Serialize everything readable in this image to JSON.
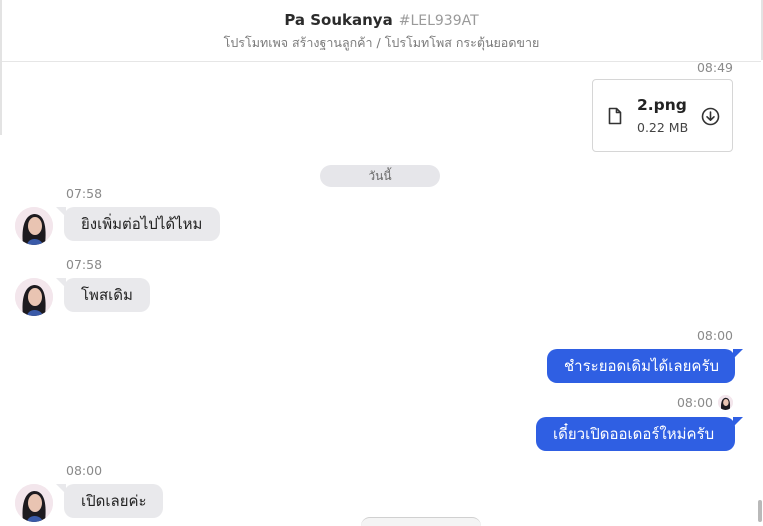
{
  "header": {
    "name": "Pa Soukanya",
    "code": "#LEL939AT",
    "tags": "โปรโมทเพจ สร้างฐานลูกค้า / โปรโมทโพส กระตุ้นยอดขาย"
  },
  "file_message": {
    "time": "08:49",
    "file_name": "2.png",
    "file_size": "0.22 MB",
    "file_icon": "document-icon",
    "download_icon": "download-circle-icon"
  },
  "day_separator": "วันนี้",
  "messages": [
    {
      "direction": "in",
      "time": "07:58",
      "text": "ยิงเพิ่มต่อไปได้ไหม"
    },
    {
      "direction": "in",
      "time": "07:58",
      "text": "โพสเดิม"
    },
    {
      "direction": "out",
      "time": "08:00",
      "text": "ชำระยอดเดิมได้เลยครับ"
    },
    {
      "direction": "out",
      "time": "08:00",
      "text": "เดี๋ยวเปิดออเดอร์ใหม่ครับ"
    },
    {
      "direction": "in",
      "time": "08:00",
      "text": "เปิดเลยค่ะ"
    }
  ],
  "colors": {
    "outgoing_bubble": "#2f5fe3",
    "incoming_bubble": "#e9e9ec",
    "day_pill": "#e6e6ea"
  }
}
